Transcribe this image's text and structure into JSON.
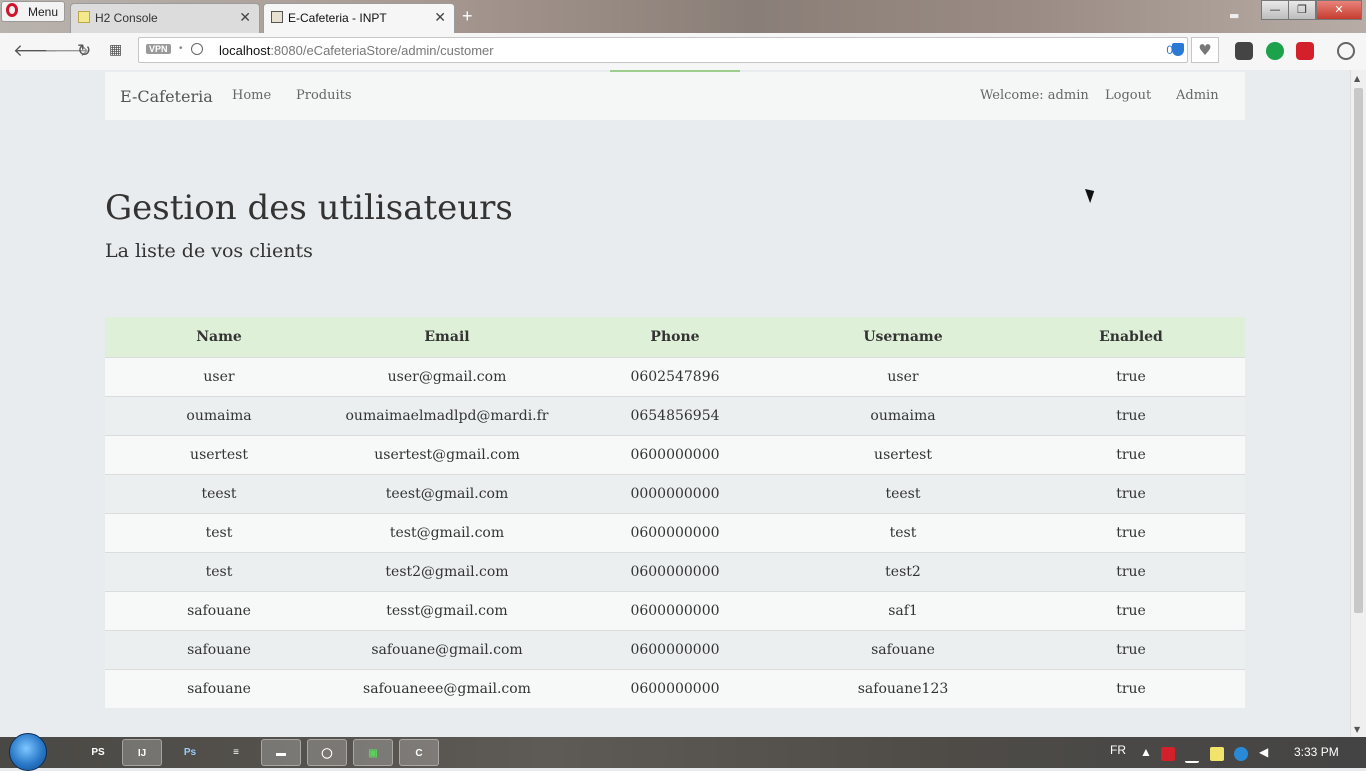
{
  "browser": {
    "menu_label": "Menu",
    "tabs": [
      {
        "title": "H2 Console",
        "active": false
      },
      {
        "title": "E-Cafeteria - INPT",
        "active": true
      }
    ],
    "new_tab_glyph": "+",
    "address": {
      "vpn_badge": "VPN",
      "url_host": "localhost",
      "url_rest": ":8080/eCafeteriaStore/admin/customer",
      "blocker_count": "0"
    },
    "extension_icons": [
      "heart-icon",
      "pocket-icon",
      "lock-extension-icon",
      "avira-icon",
      "download-icon"
    ]
  },
  "navbar": {
    "brand": "E-Cafeteria",
    "links": [
      "Home",
      "Produits"
    ],
    "welcome": "Welcome: admin",
    "logout": "Logout",
    "admin": "Admin"
  },
  "page": {
    "title": "Gestion des utilisateurs",
    "subtitle": "La liste de vos clients"
  },
  "table": {
    "headers": [
      "Name",
      "Email",
      "Phone",
      "Username",
      "Enabled"
    ],
    "rows": [
      [
        "user",
        "user@gmail.com",
        "0602547896",
        "user",
        "true"
      ],
      [
        "oumaima",
        "oumaimaelmadlpd@mardi.fr",
        "0654856954",
        "oumaima",
        "true"
      ],
      [
        "usertest",
        "usertest@gmail.com",
        "0600000000",
        "usertest",
        "true"
      ],
      [
        "teest",
        "teest@gmail.com",
        "0000000000",
        "teest",
        "true"
      ],
      [
        "test",
        "test@gmail.com",
        "0600000000",
        "test",
        "true"
      ],
      [
        "test",
        "test2@gmail.com",
        "0600000000",
        "test2",
        "true"
      ],
      [
        "safouane",
        "tesst@gmail.com",
        "0600000000",
        "saf1",
        "true"
      ],
      [
        "safouane",
        "safouane@gmail.com",
        "0600000000",
        "safouane",
        "true"
      ],
      [
        "safouane",
        "safouaneee@gmail.com",
        "0600000000",
        "safouane123",
        "true"
      ]
    ]
  },
  "taskbar": {
    "items": [
      "PS",
      "IJ",
      "Ps",
      "",
      "",
      "",
      "",
      "C"
    ],
    "language": "FR",
    "time": "3:33 PM"
  },
  "colors": {
    "table_header_bg": "#dff0d8",
    "page_bg": "#e9ecee",
    "green_accent": "#9ccd8c"
  }
}
